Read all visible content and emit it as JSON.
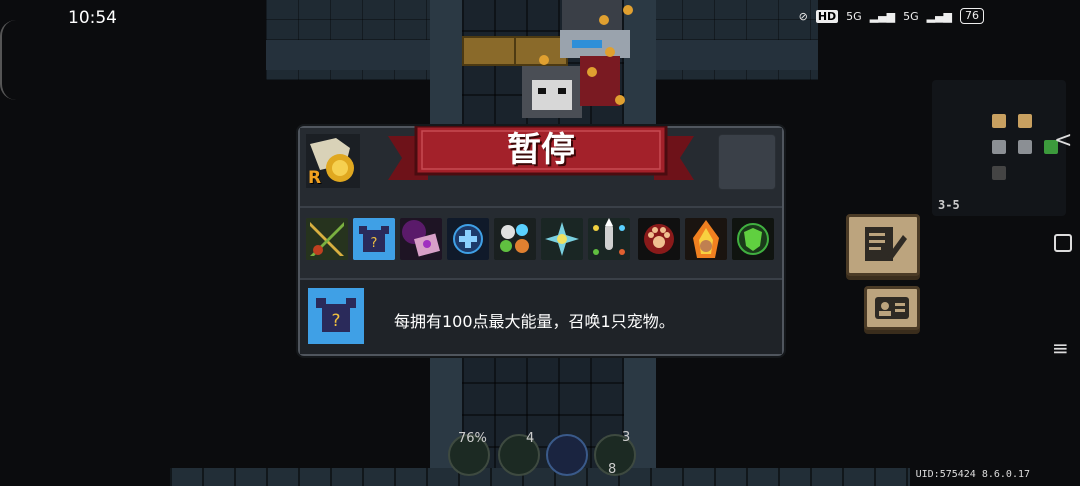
{
  "status_bar": {
    "time": "10:54",
    "hd_label": "HD",
    "net1": "5G",
    "net2": "5G",
    "battery": "76"
  },
  "pause_menu": {
    "title": "暂停",
    "weapon_badge": "R",
    "buffs": [
      {
        "icon": "swords-buff-icon"
      },
      {
        "icon": "summon-pet-buff-icon"
      },
      {
        "icon": "magic-scroll-buff-icon"
      },
      {
        "icon": "shield-cross-buff-icon"
      },
      {
        "icon": "elemental-orbs-buff-icon"
      },
      {
        "icon": "element-burst-buff-icon"
      },
      {
        "icon": "bullet-element-buff-icon"
      },
      {
        "icon": "paw-buff-icon"
      },
      {
        "icon": "flame-pet-buff-icon"
      },
      {
        "icon": "green-shield-buff-icon"
      }
    ],
    "selected_buff_description": "每拥有100点最大能量，召唤1只宠物。"
  },
  "minimap": {
    "level": "3-5"
  },
  "hud": {
    "skill1_percent": "76%",
    "skill2_count": "4",
    "skill4_count": "3",
    "skill4_sub": "8"
  },
  "footer": {
    "uid": "UID:575424 8.6.0.17"
  },
  "colors": {
    "banner_red": "#a3212a",
    "panel_bg": "#262b31",
    "buff_blue": "#3fa0e6"
  }
}
